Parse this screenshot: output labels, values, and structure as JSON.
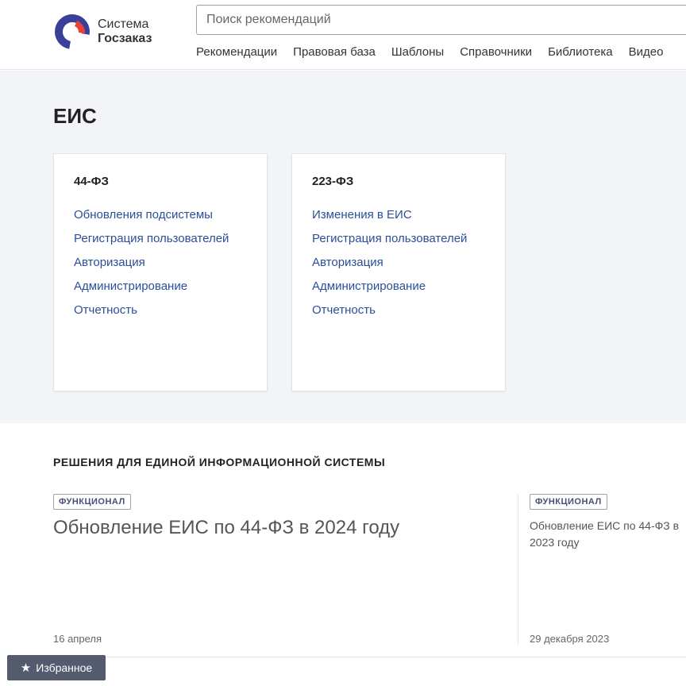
{
  "header": {
    "logo_line1": "Система",
    "logo_line2": "Госзаказ",
    "search_placeholder": "Поиск рекомендаций",
    "nav": [
      "Рекомендации",
      "Правовая база",
      "Шаблоны",
      "Справочники",
      "Библиотека",
      "Видео"
    ]
  },
  "eis": {
    "title": "ЕИС",
    "cards": [
      {
        "title": "44-ФЗ",
        "links": [
          "Обновления подсистемы",
          "Регистрация пользователей",
          "Авторизация",
          "Администрирование",
          "Отчетность"
        ]
      },
      {
        "title": "223-ФЗ",
        "links": [
          "Изменения в ЕИС",
          "Регистрация пользователей",
          "Авторизация",
          "Администрирование",
          "Отчетность"
        ]
      }
    ]
  },
  "solutions": {
    "title": "РЕШЕНИЯ ДЛЯ ЕДИНОЙ ИНФОРМАЦИОННОЙ СИСТЕМЫ",
    "articles": [
      {
        "tag": "ФУНКЦИОНАЛ",
        "title": "Обновление ЕИС по 44-ФЗ в 2024 году",
        "date": "16 апреля"
      },
      {
        "tag": "ФУНКЦИОНАЛ",
        "title": "Обновление ЕИС по 44-ФЗ в 2023 году",
        "date": "29 декабря 2023"
      }
    ]
  },
  "favorites": {
    "label": "Избранное",
    "icon": "star-icon"
  },
  "colors": {
    "brand_blue": "#3a3f9a",
    "brand_red": "#e8413a",
    "link": "#2b4e9a",
    "section_bg": "#f3f4f7"
  }
}
